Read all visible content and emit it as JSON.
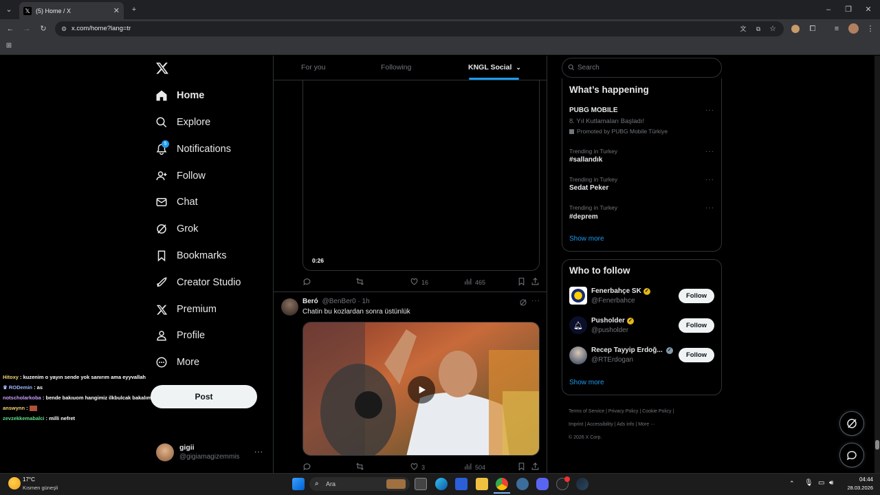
{
  "browser": {
    "tab_title": "(5) Home / X",
    "url": "x.com/home?lang=tr"
  },
  "sidebar": {
    "items": [
      {
        "label": "Home",
        "icon": "home-icon"
      },
      {
        "label": "Explore",
        "icon": "search-icon"
      },
      {
        "label": "Notifications",
        "icon": "bell-icon",
        "badge": "5"
      },
      {
        "label": "Follow",
        "icon": "person-add-icon"
      },
      {
        "label": "Chat",
        "icon": "mail-icon"
      },
      {
        "label": "Grok",
        "icon": "grok-icon"
      },
      {
        "label": "Bookmarks",
        "icon": "bookmark-icon"
      },
      {
        "label": "Creator Studio",
        "icon": "rocket-icon"
      },
      {
        "label": "Premium",
        "icon": "x-logo-icon"
      },
      {
        "label": "Profile",
        "icon": "person-icon"
      },
      {
        "label": "More",
        "icon": "more-circle-icon"
      }
    ],
    "post_label": "Post",
    "profile": {
      "name": "gigii",
      "handle": "@gigiamagizemmis"
    }
  },
  "feed": {
    "tabs": [
      "For you",
      "Following",
      "KNGL Social"
    ],
    "tweet1": {
      "video_time": "0:26",
      "likes": "16",
      "views": "465"
    },
    "tweet2": {
      "name": "Beró",
      "handle_time": "@BenBer0 · 1h",
      "text": "Chatin bu kozlardan sonra üstünlük",
      "likes": "3",
      "views": "504"
    }
  },
  "right": {
    "search_placeholder": "Search",
    "happening": {
      "title": "What’s happening",
      "promo": {
        "name": "PUBG MOBILE",
        "desc": "8. Yıl Kutlamaları Başladı!",
        "promoted": "Promoted by PUBG Mobile Türkiye"
      },
      "trends": [
        {
          "context": "Trending in Turkey",
          "name": "#sallandık"
        },
        {
          "context": "Trending in Turkey",
          "name": "Sedat Peker"
        },
        {
          "context": "Trending in Turkey",
          "name": "#deprem"
        }
      ],
      "show_more": "Show more"
    },
    "who_to_follow": {
      "title": "Who to follow",
      "users": [
        {
          "name": "Fenerbahçe SK",
          "handle": "@Fenerbahce",
          "badge": "gold"
        },
        {
          "name": "Pusholder",
          "handle": "@pusholder",
          "badge": "gold"
        },
        {
          "name": "Recep Tayyip Erdoğ...",
          "handle": "@RTErdogan",
          "badge": "grey"
        }
      ],
      "follow_label": "Follow",
      "show_more": "Show more"
    },
    "footer": {
      "line1": [
        "Terms of Service",
        "Privacy Policy",
        "Cookie Policy"
      ],
      "line2": [
        "Imprint",
        "Accessibility",
        "Ads info",
        "More ···"
      ],
      "copyright": "© 2026 X Corp."
    }
  },
  "chat_overlay": [
    {
      "user": "Hitoxy",
      "msg": " : kuzenim o yayın sende yok sanırım ama eyyvallah",
      "color": "#f5d76e"
    },
    {
      "user": "RODemin",
      "msg": " : as",
      "color": "#9fb8ff"
    },
    {
      "user": "notscholarkoba",
      "msg": " : bende bakıuom hangimiz ilkbulcak bakalım",
      "color": "#c9a0ff"
    },
    {
      "user": "answynn",
      "msg": " : ",
      "color": "#f5d76e"
    },
    {
      "user": "zevzekkemabalci",
      "msg": " : milli nefret",
      "color": "#5fe08a"
    }
  ],
  "taskbar": {
    "weather_temp": "17°C",
    "weather_desc": "Kısmen güneşli",
    "search_label": "Ara",
    "time": "04:44",
    "date": "28.03.2026"
  },
  "colors": {
    "accent": "#1d9bf0",
    "border": "#2f3336",
    "muted": "#71767b"
  }
}
